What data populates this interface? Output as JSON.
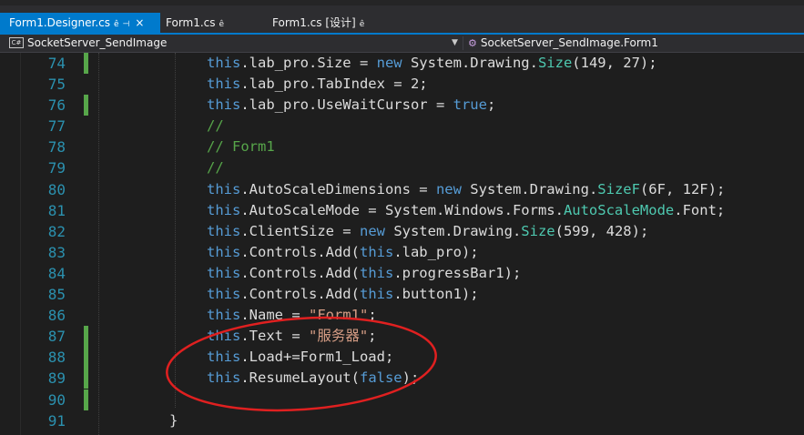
{
  "tabs": [
    {
      "label": "Form1.Designer.cs",
      "lock": "ê",
      "pin": "⊣",
      "close": "×"
    },
    {
      "label": "Form1.cs",
      "lock": "ê"
    },
    {
      "label": "Form1.cs [设计]",
      "lock": "ê"
    }
  ],
  "nav": {
    "left": "SocketServer_SendImage",
    "right": "SocketServer_SendImage.Form1",
    "badge": "C#"
  },
  "code": {
    "lines": [
      {
        "n": "74",
        "changed": true
      },
      {
        "n": "75",
        "changed": false
      },
      {
        "n": "76",
        "changed": true
      },
      {
        "n": "77",
        "changed": false
      },
      {
        "n": "78",
        "changed": false
      },
      {
        "n": "79",
        "changed": false
      },
      {
        "n": "80",
        "changed": false
      },
      {
        "n": "81",
        "changed": false
      },
      {
        "n": "82",
        "changed": false
      },
      {
        "n": "83",
        "changed": false
      },
      {
        "n": "84",
        "changed": false
      },
      {
        "n": "85",
        "changed": false
      },
      {
        "n": "86",
        "changed": false
      },
      {
        "n": "87",
        "changed": true
      },
      {
        "n": "88",
        "changed": true
      },
      {
        "n": "89",
        "changed": true
      },
      {
        "n": "90",
        "changed": true
      },
      {
        "n": "91",
        "changed": false
      }
    ],
    "closing_brace": "}"
  },
  "colors": {
    "keyword": "#569cd6",
    "type": "#4ec9b0",
    "comment": "#57a64a",
    "string": "#d69d85",
    "line_number": "#2b91af",
    "annotation_circle": "#e02020",
    "active_tab": "#007acc"
  }
}
